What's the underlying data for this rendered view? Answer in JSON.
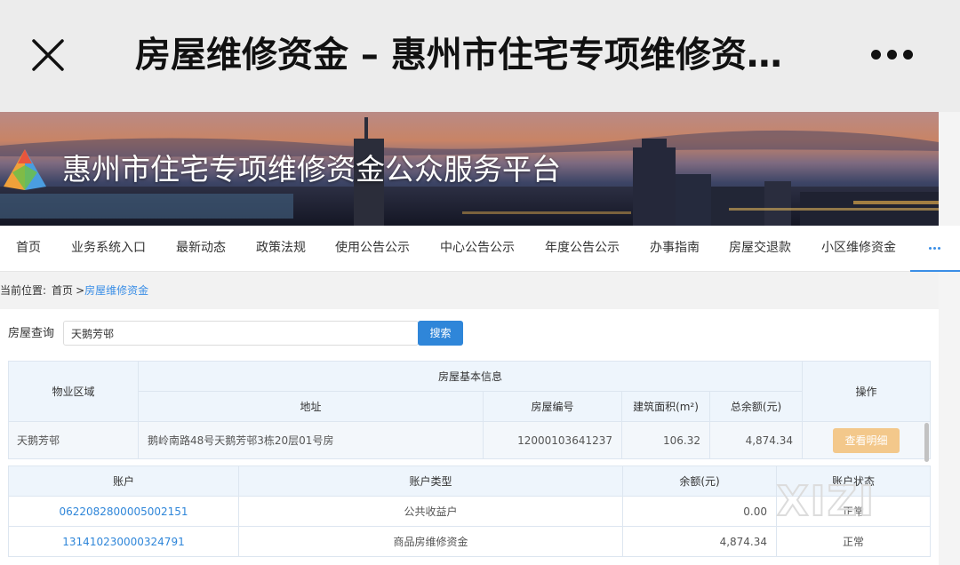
{
  "topbar": {
    "title": "房屋维修资金 – 惠州市住宅专项维修资金公众服务平台",
    "close_icon": "close-icon",
    "more_icon": "more-dots-icon"
  },
  "banner": {
    "title": "惠州市住宅专项维修资金公众服务平台",
    "logo_icon": "pyramid-logo-icon"
  },
  "nav": {
    "items": [
      "首页",
      "业务系统入口",
      "最新动态",
      "政策法规",
      "使用公告公示",
      "中心公告公示",
      "年度公告公示",
      "办事指南",
      "房屋交退款",
      "小区维修资金"
    ],
    "more_icon": "more-dots-icon"
  },
  "breadcrumb": {
    "label": "当前位置:",
    "home": "首页",
    "separator": ">",
    "current": "房屋维修资金"
  },
  "search": {
    "label": "房屋查询",
    "value": "天鹅芳邨",
    "button": "搜索"
  },
  "house_table": {
    "col_area": "物业区域",
    "group_header": "房屋基本信息",
    "col_action": "操作",
    "sub_headers": [
      "地址",
      "房屋编号",
      "建筑面积(m²)",
      "总余额(元)"
    ],
    "row": {
      "area": "天鹅芳邨",
      "address": "鹅岭南路48号天鹅芳邨3栋20层01号房",
      "house_no": "12000103641237",
      "building_area": "106.32",
      "total_balance": "4,874.34",
      "action": "查看明细"
    }
  },
  "account_table": {
    "headers": [
      "账户",
      "账户类型",
      "余额(元)",
      "账户状态"
    ],
    "rows": [
      {
        "account": "0622082800005002151",
        "type": "公共收益户",
        "balance": "0.00",
        "status": "正常"
      },
      {
        "account": "131410230000324791",
        "type": "商品房维修资金",
        "balance": "4,874.34",
        "status": "正常"
      }
    ]
  },
  "watermark": {
    "text": "XIZI"
  },
  "colors": {
    "link": "#2f86d9",
    "search_button": "#2f86d9",
    "view_button": "#f3c88b",
    "header_bg": "#eef5fc",
    "topbar_bg": "#ececec"
  }
}
